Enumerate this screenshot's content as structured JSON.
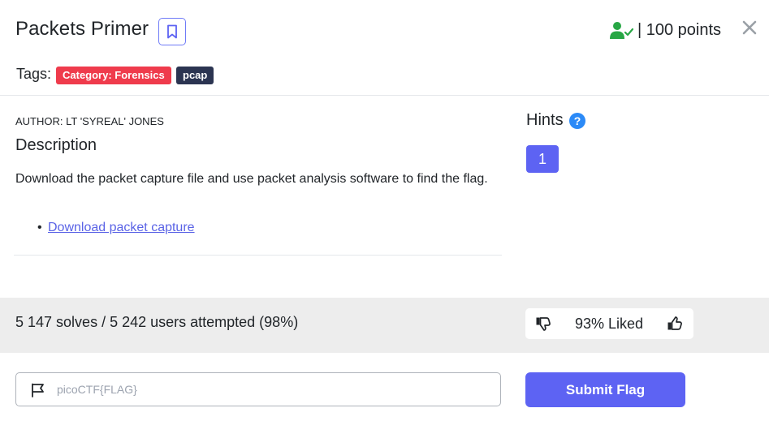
{
  "challenge": {
    "title": "Packets Primer",
    "points": "| 100 points",
    "tags_label": "Tags:",
    "tags": [
      "Category: Forensics",
      "pcap"
    ]
  },
  "description": {
    "author": "AUTHOR: LT 'SYREAL' JONES",
    "heading": "Description",
    "text": "Download the packet capture file and use packet analysis software to find the flag.",
    "download_link": "Download packet capture"
  },
  "hints": {
    "heading": "Hints",
    "help_symbol": "?",
    "items": [
      "1"
    ]
  },
  "stats": {
    "solves": "5 147 solves / 5 242 users attempted (98%)",
    "liked": "93% Liked"
  },
  "flag_form": {
    "placeholder": "picoCTF{FLAG}",
    "value": "",
    "submit_label": "Submit Flag"
  },
  "colors": {
    "accent": "#5d63f3",
    "category_tag": "#ef3b4c",
    "pcap_tag": "#2b3451",
    "solved_icon": "#28a745",
    "help_icon": "#2b8af7",
    "stats_bar": "#ededed"
  },
  "icons": [
    "bookmark-icon",
    "user-check-icon",
    "close-icon",
    "help-icon",
    "thumbs-down-icon",
    "thumbs-up-icon",
    "flag-icon"
  ]
}
